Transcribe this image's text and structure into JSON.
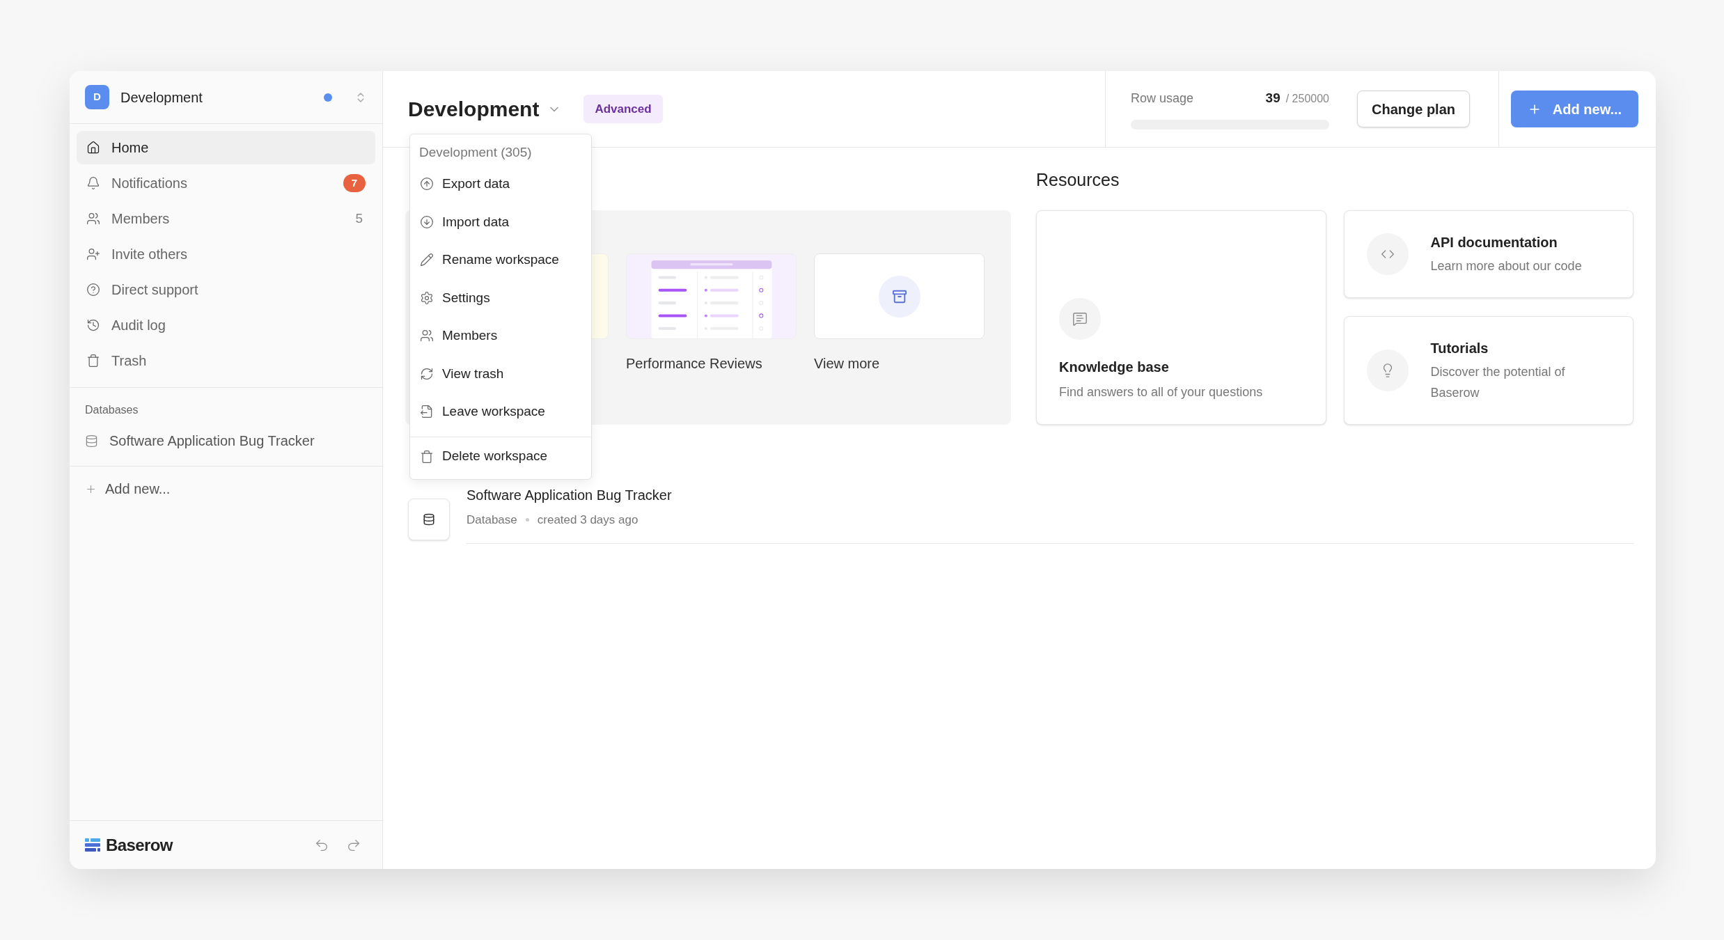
{
  "workspace_switcher": {
    "initial": "D",
    "name": "Development",
    "unread": true
  },
  "sidebar": {
    "items": [
      {
        "label": "Home",
        "selected": true
      },
      {
        "label": "Notifications",
        "selected": false,
        "badge": "7"
      },
      {
        "label": "Members",
        "selected": false,
        "count": "5"
      },
      {
        "label": "Invite others",
        "selected": false
      },
      {
        "label": "Direct support",
        "selected": false
      },
      {
        "label": "Audit log",
        "selected": false
      },
      {
        "label": "Trash",
        "selected": false
      }
    ],
    "section_title": "Databases",
    "databases": [
      {
        "label": "Software Application Bug Tracker"
      }
    ],
    "add_new": "Add new..."
  },
  "footer": {
    "brand": "Baserow"
  },
  "header": {
    "title": "Development",
    "plan": "Advanced",
    "row_usage": {
      "label": "Row usage",
      "used": "39",
      "limit": "/ 250000",
      "level": 0.0002
    },
    "change_plan": "Change plan",
    "add_new": "Add new..."
  },
  "workspace_menu": {
    "heading": "Development (305)",
    "items": [
      {
        "label": "Export data"
      },
      {
        "label": "Import data"
      },
      {
        "label": "Rename workspace"
      },
      {
        "label": "Settings"
      },
      {
        "label": "Members"
      },
      {
        "label": "View trash"
      },
      {
        "label": "Leave workspace"
      }
    ],
    "footer_item": "Delete workspace"
  },
  "templates": [
    {
      "kind": "partial"
    },
    {
      "kind": "table",
      "label": "Performance Reviews"
    },
    {
      "kind": "more",
      "label": "View more"
    }
  ],
  "resources": {
    "title": "Resources",
    "cards": [
      {
        "kind": "large",
        "title": "Knowledge base",
        "text": "Find answers to all of your questions"
      },
      {
        "kind": "small",
        "title": "API documentation",
        "text": "Learn more about our code"
      },
      {
        "kind": "small",
        "title": "Tutorials",
        "text": "Discover the potential of Baserow"
      }
    ]
  },
  "databases_list": [
    {
      "name": "Software Application Bug Tracker",
      "type": "Database",
      "created": "created 3 days ago"
    }
  ]
}
